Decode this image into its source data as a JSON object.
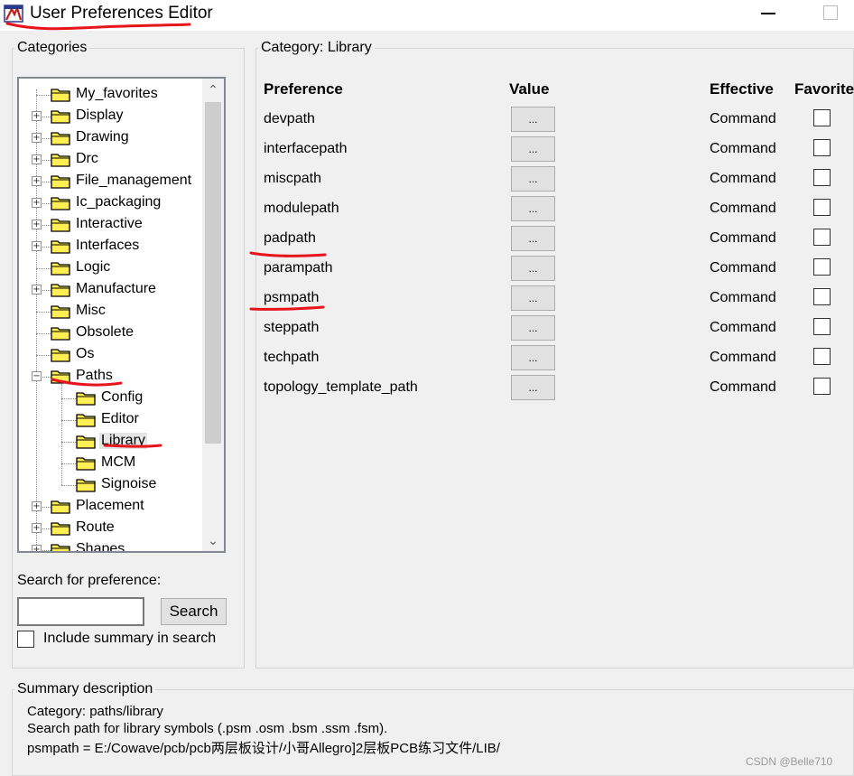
{
  "window": {
    "title": "User Preferences Editor"
  },
  "categories_panel": {
    "legend": "Categories",
    "tree": [
      {
        "label": "My_favorites",
        "depth": 0,
        "expander": ""
      },
      {
        "label": "Display",
        "depth": 0,
        "expander": "+"
      },
      {
        "label": "Drawing",
        "depth": 0,
        "expander": "+"
      },
      {
        "label": "Drc",
        "depth": 0,
        "expander": "+"
      },
      {
        "label": "File_management",
        "depth": 0,
        "expander": "+"
      },
      {
        "label": "Ic_packaging",
        "depth": 0,
        "expander": "+"
      },
      {
        "label": "Interactive",
        "depth": 0,
        "expander": "+"
      },
      {
        "label": "Interfaces",
        "depth": 0,
        "expander": "+"
      },
      {
        "label": "Logic",
        "depth": 0,
        "expander": ""
      },
      {
        "label": "Manufacture",
        "depth": 0,
        "expander": "+"
      },
      {
        "label": "Misc",
        "depth": 0,
        "expander": ""
      },
      {
        "label": "Obsolete",
        "depth": 0,
        "expander": ""
      },
      {
        "label": "Os",
        "depth": 0,
        "expander": ""
      },
      {
        "label": "Paths",
        "depth": 0,
        "expander": "−"
      },
      {
        "label": "Config",
        "depth": 1,
        "expander": ""
      },
      {
        "label": "Editor",
        "depth": 1,
        "expander": ""
      },
      {
        "label": "Library",
        "depth": 1,
        "expander": "",
        "selected": true
      },
      {
        "label": "MCM",
        "depth": 1,
        "expander": ""
      },
      {
        "label": "Signoise",
        "depth": 1,
        "expander": ""
      },
      {
        "label": "Placement",
        "depth": 0,
        "expander": "+"
      },
      {
        "label": "Route",
        "depth": 0,
        "expander": "+"
      },
      {
        "label": "Shapes",
        "depth": 0,
        "expander": "+"
      }
    ],
    "search_label": "Search for preference:",
    "search_value": "",
    "search_button": "Search",
    "include_summary_label": "Include summary in search",
    "include_summary_checked": false
  },
  "category_panel": {
    "legend": "Category:  Library",
    "columns": {
      "preference": "Preference",
      "value": "Value",
      "effective": "Effective",
      "favorite": "Favorite"
    },
    "rows": [
      {
        "name": "devpath",
        "value_button": "...",
        "effective": "Command",
        "favorite": false
      },
      {
        "name": "interfacepath",
        "value_button": "...",
        "effective": "Command",
        "favorite": false
      },
      {
        "name": "miscpath",
        "value_button": "...",
        "effective": "Command",
        "favorite": false
      },
      {
        "name": "modulepath",
        "value_button": "...",
        "effective": "Command",
        "favorite": false
      },
      {
        "name": "padpath",
        "value_button": "...",
        "effective": "Command",
        "favorite": false
      },
      {
        "name": "parampath",
        "value_button": "...",
        "effective": "Command",
        "favorite": false
      },
      {
        "name": "psmpath",
        "value_button": "...",
        "effective": "Command",
        "favorite": false
      },
      {
        "name": "steppath",
        "value_button": "...",
        "effective": "Command",
        "favorite": false
      },
      {
        "name": "techpath",
        "value_button": "...",
        "effective": "Command",
        "favorite": false
      },
      {
        "name": "topology_template_path",
        "value_button": "...",
        "effective": "Command",
        "favorite": false
      }
    ]
  },
  "summary": {
    "legend": "Summary description",
    "lines": [
      "Category: paths/library",
      "Search path for library symbols (.psm .osm .bsm .ssm .fsm).",
      "psmpath = E:/Cowave/pcb/pcb两层板设计/小哥Allegro]2层板PCB练习文件/LIB/"
    ]
  },
  "watermark": "CSDN @Belle710",
  "colors": {
    "annotation": "#e8141c",
    "folder_fill": "#ffee55",
    "window_bg": "#f0f0f0"
  }
}
